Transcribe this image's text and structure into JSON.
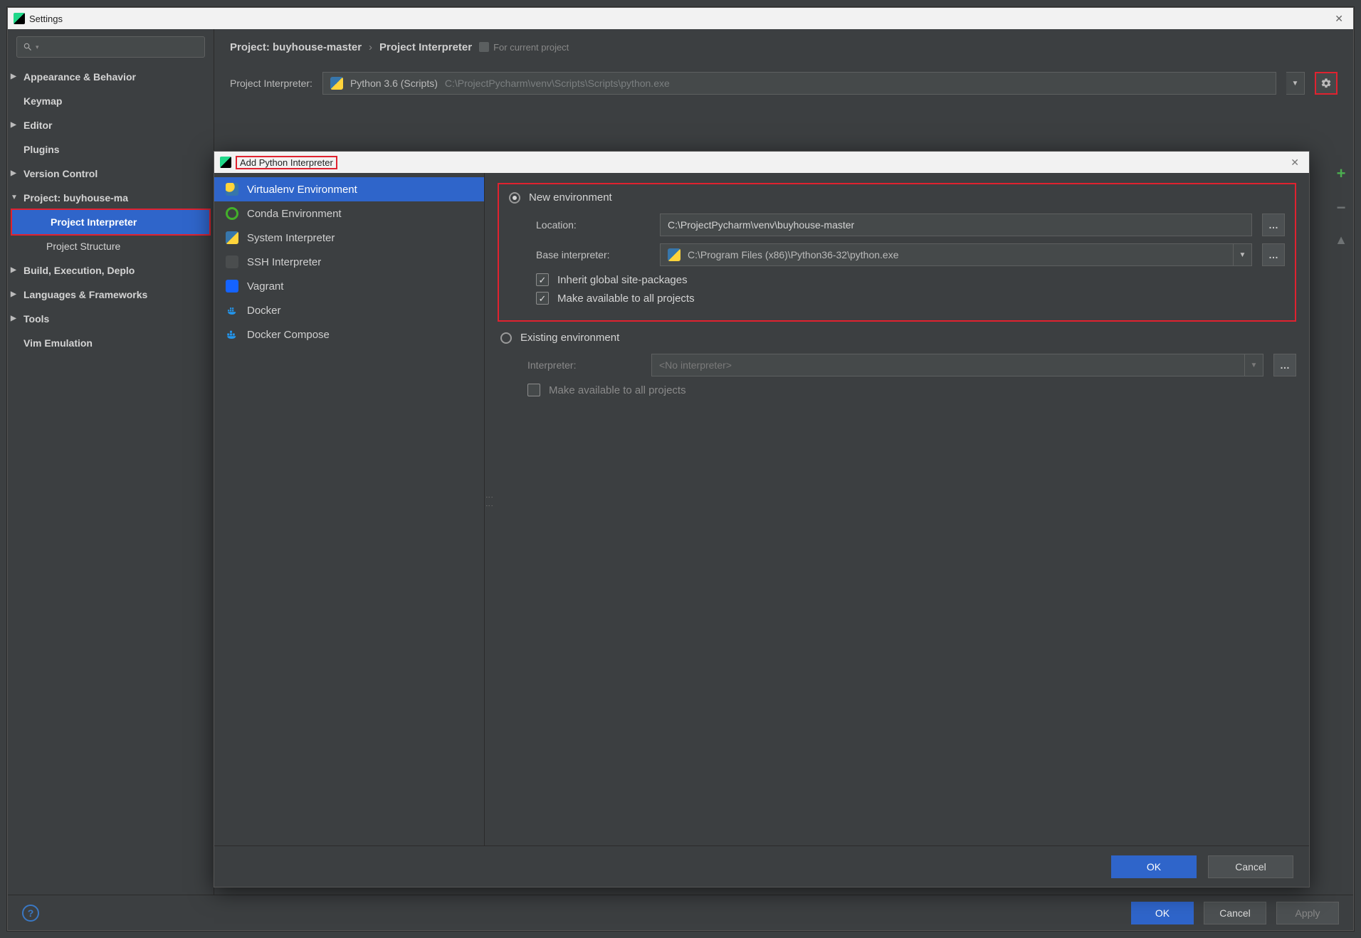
{
  "settings": {
    "title": "Settings",
    "sidebar": {
      "items": [
        {
          "label": "Appearance & Behavior",
          "expandable": true,
          "bold": true
        },
        {
          "label": "Keymap",
          "bold": true
        },
        {
          "label": "Editor",
          "expandable": true,
          "bold": true
        },
        {
          "label": "Plugins",
          "bold": true
        },
        {
          "label": "Version Control",
          "expandable": true,
          "bold": true
        },
        {
          "label": "Project: buyhouse-ma",
          "expandable": true,
          "expanded": true,
          "bold": true
        },
        {
          "label": "Project Interpreter",
          "child": true,
          "selected": true
        },
        {
          "label": "Project Structure",
          "child": true
        },
        {
          "label": "Build, Execution, Deplo",
          "expandable": true,
          "bold": true
        },
        {
          "label": "Languages & Frameworks",
          "expandable": true,
          "bold": true
        },
        {
          "label": "Tools",
          "expandable": true,
          "bold": true
        },
        {
          "label": "Vim Emulation",
          "bold": true
        }
      ]
    },
    "breadcrumb": {
      "part1": "Project: buyhouse-master",
      "part2": "Project Interpreter",
      "forCurrent": "For current project"
    },
    "interpreter": {
      "label": "Project Interpreter:",
      "name": "Python 3.6 (Scripts)",
      "path": "C:\\ProjectPycharm\\venv\\Scripts\\Scripts\\python.exe"
    },
    "footer": {
      "ok": "OK",
      "cancel": "Cancel",
      "apply": "Apply"
    }
  },
  "dialog": {
    "title": "Add Python Interpreter",
    "sidebar": [
      {
        "label": "Virtualenv Environment",
        "icon": "venv",
        "selected": true
      },
      {
        "label": "Conda Environment",
        "icon": "conda"
      },
      {
        "label": "System Interpreter",
        "icon": "system"
      },
      {
        "label": "SSH Interpreter",
        "icon": "ssh"
      },
      {
        "label": "Vagrant",
        "icon": "vagrant"
      },
      {
        "label": "Docker",
        "icon": "docker"
      },
      {
        "label": "Docker Compose",
        "icon": "dcompose"
      }
    ],
    "newEnv": {
      "radioLabel": "New environment",
      "locationLabel": "Location:",
      "locationValue": "C:\\ProjectPycharm\\venv\\buyhouse-master",
      "baseLabel": "Base interpreter:",
      "baseValue": "C:\\Program Files (x86)\\Python36-32\\python.exe",
      "inherit": "Inherit global site-packages",
      "makeAvail": "Make available to all projects"
    },
    "existing": {
      "radioLabel": "Existing environment",
      "interpLabel": "Interpreter:",
      "interpValue": "<No interpreter>",
      "makeAvail": "Make available to all projects"
    },
    "footer": {
      "ok": "OK",
      "cancel": "Cancel"
    }
  }
}
